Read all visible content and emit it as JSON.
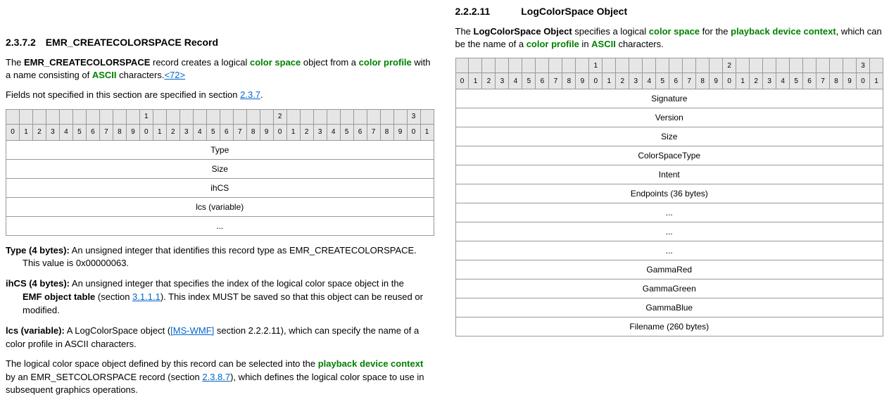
{
  "left": {
    "heading_num": "2.3.7.2",
    "heading_title": "EMR_CREATECOLORSPACE Record",
    "intro_pre": "The ",
    "intro_b1": "EMR_CREATECOLORSPACE",
    "intro_mid1": " record creates a logical ",
    "intro_g1": "color space",
    "intro_mid2": " object from a ",
    "intro_g2": "color profile",
    "intro_mid3": " with a name consisting of ",
    "intro_g3": "ASCII",
    "intro_post": " characters.",
    "intro_link": "<72>",
    "fields_not": "Fields not specified in this section are specified in section ",
    "fields_not_link": "2.3.7",
    "fields_not_dot": ".",
    "rows": [
      "Type",
      "Size",
      "ihCS",
      "lcs (variable)",
      "..."
    ],
    "fd1_b": "Type (4 bytes):",
    "fd1_t1": " An unsigned integer that identifies this record type as EMR_CREATECOLORSPACE.",
    "fd1_t2": "This value is 0x00000063.",
    "fd2_b": "ihCS (4 bytes):",
    "fd2_t1": " An unsigned integer that specifies the index of the logical color space object in the ",
    "fd2_b2": "EMF object table",
    "fd2_t2": " (section ",
    "fd2_link": "3.1.1.1",
    "fd2_t3": "). This index MUST be saved so that this object can be reused or modified.",
    "fd3_b": "lcs (variable):",
    "fd3_t1": " A LogColorSpace object (",
    "fd3_link": "[MS-WMF]",
    "fd3_t2": " section 2.2.2.11), which can specify the name of a color profile in ASCII characters.",
    "last_p1": "The logical color space object defined by this record can be selected into the ",
    "last_g": "playback device context",
    "last_p2": " by an EMR_SETCOLORSPACE record (section ",
    "last_link": "2.3.8.7",
    "last_p3": "), which defines the logical color space to use in subsequent graphics operations."
  },
  "right": {
    "heading_num": "2.2.2.11",
    "heading_title": "LogColorSpace Object",
    "intro_pre": "The ",
    "intro_b1": "LogColorSpace Object",
    "intro_mid1": " specifies a logical ",
    "intro_g1": "color space",
    "intro_mid2": " for the ",
    "intro_g2": "playback device context",
    "intro_mid3": ", which can be the name of a ",
    "intro_g3": "color profile",
    "intro_mid4": " in ",
    "intro_g4": "ASCII",
    "intro_post": " characters.",
    "rows": [
      "Signature",
      "Version",
      "Size",
      "ColorSpaceType",
      "Intent",
      "Endpoints (36 bytes)",
      "...",
      "...",
      "...",
      "GammaRed",
      "GammaGreen",
      "GammaBlue",
      "Filename (260 bytes)"
    ]
  },
  "bits": {
    "tens": [
      "",
      "",
      "",
      "",
      "",
      "",
      "",
      "",
      "",
      "",
      "1",
      "",
      "",
      "",
      "",
      "",
      "",
      "",
      "",
      "",
      "2",
      "",
      "",
      "",
      "",
      "",
      "",
      "",
      "",
      "",
      "3",
      ""
    ],
    "ones": [
      "0",
      "1",
      "2",
      "3",
      "4",
      "5",
      "6",
      "7",
      "8",
      "9",
      "0",
      "1",
      "2",
      "3",
      "4",
      "5",
      "6",
      "7",
      "8",
      "9",
      "0",
      "1",
      "2",
      "3",
      "4",
      "5",
      "6",
      "7",
      "8",
      "9",
      "0",
      "1"
    ]
  }
}
